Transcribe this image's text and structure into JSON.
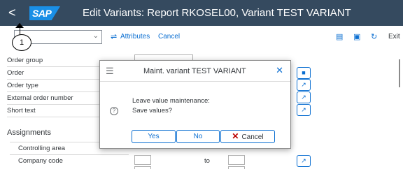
{
  "shell": {
    "back_glyph": "<",
    "logo_text": "SAP",
    "title": "Edit Variants: Report RKOSEL00, Variant TEST VARIANT"
  },
  "toolbar": {
    "callout_number": "1",
    "attributes_label": "Attributes",
    "cancel_label": "Cancel",
    "exit_label": "Exit"
  },
  "form": {
    "rows": [
      "Order group",
      "Order",
      "Order type",
      "External order number",
      "Short text"
    ],
    "section_title": "Assignments",
    "sub_rows": [
      "Controlling area",
      "Company code"
    ],
    "to_label": "to"
  },
  "dialog": {
    "title": "Maint. variant TEST VARIANT",
    "message_line1": "Leave value maintenance:",
    "message_line2": "Save values?",
    "yes_label": "Yes",
    "no_label": "No",
    "cancel_label": "Cancel"
  },
  "colors": {
    "shell_bg": "#354a5f",
    "accent": "#0a6ed1",
    "cancel_x": "#bb0000"
  }
}
